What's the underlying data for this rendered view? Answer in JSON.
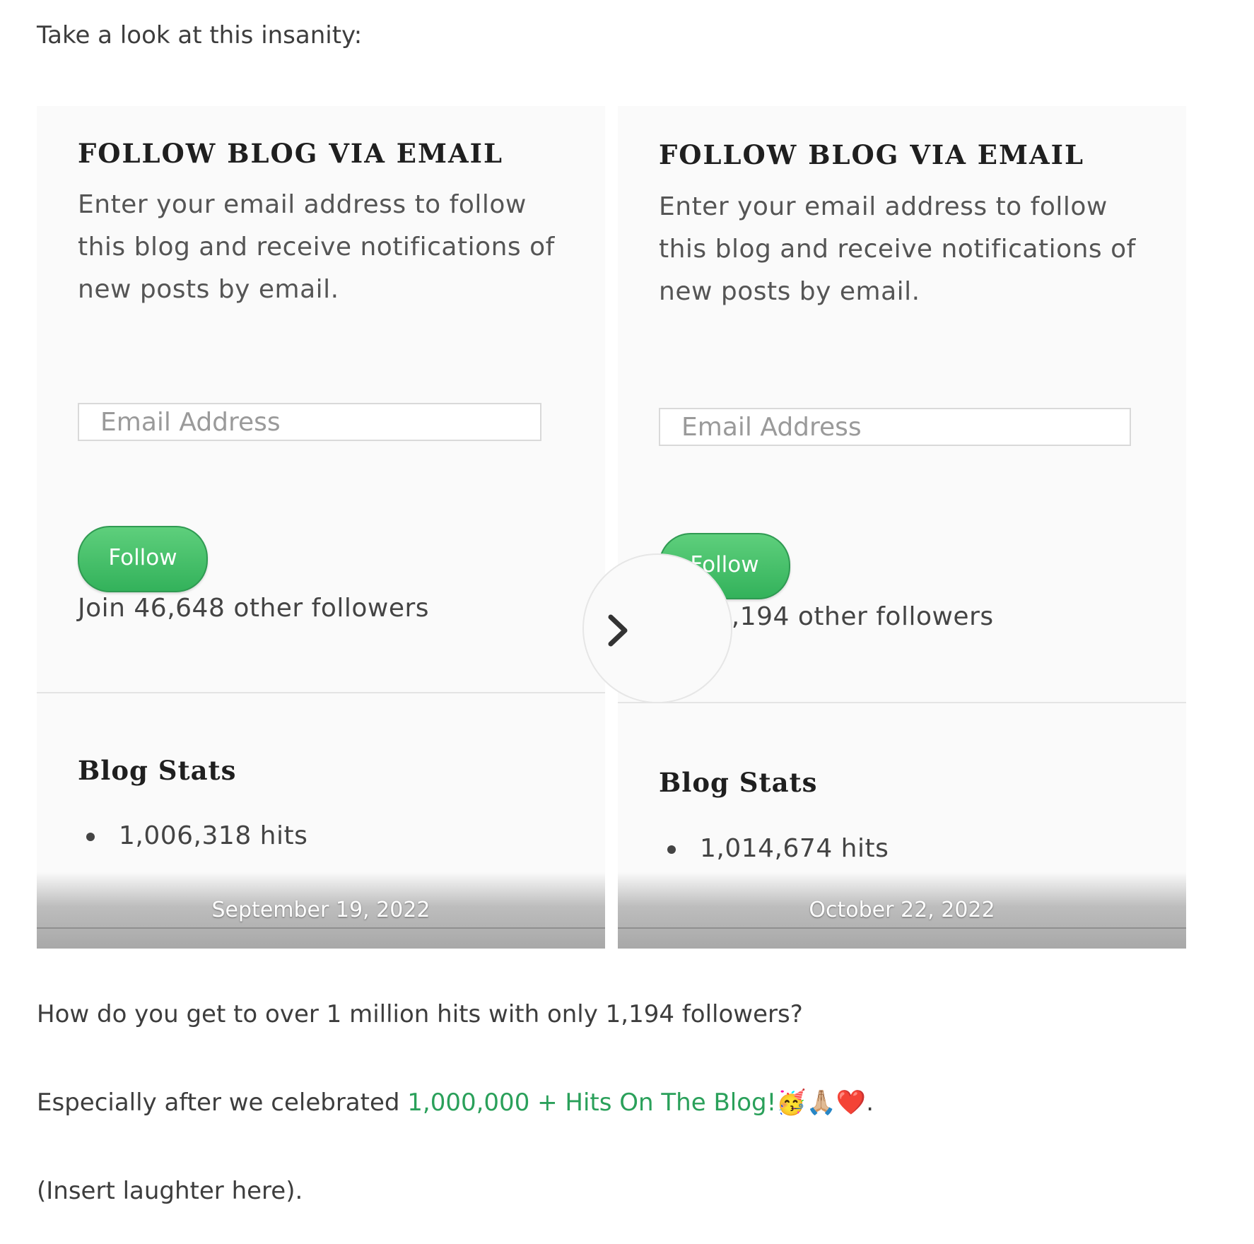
{
  "intro_text": "Take a look at this insanity:",
  "screenshots": [
    {
      "title": "FOLLOW BLOG VIA EMAIL",
      "description": "Enter your email address to follow this blog and receive notifications of new posts by email.",
      "email_placeholder": "Email Address",
      "follow_label": "Follow",
      "followers_text": "Join 46,648 other followers",
      "stats_title": "Blog Stats",
      "hits": "1,006,318 hits",
      "caption": "September 19, 2022"
    },
    {
      "title": "FOLLOW BLOG VIA EMAIL",
      "description": "Enter your email address to follow this blog and receive notifications of new posts by email.",
      "email_placeholder": "Email Address",
      "follow_label": "Follow",
      "followers_text": "Join 1,194 other followers",
      "stats_title": "Blog Stats",
      "hits": "1,014,674 hits",
      "caption": "October 22, 2022"
    }
  ],
  "question_text": "How do you get to over 1 million hits with only 1,194 followers?",
  "especially": {
    "prefix": "Especially after we celebrated ",
    "link_text": "1,000,000 + Hits On The Blog!",
    "emojis": "🥳🙏🏼❤️",
    "suffix": "."
  },
  "laughter_text": "(Insert laughter here).",
  "colors": {
    "link": "#2aa05a",
    "follow_button": "#3fbf66"
  },
  "icons": {
    "next": "chevron-right-icon"
  }
}
